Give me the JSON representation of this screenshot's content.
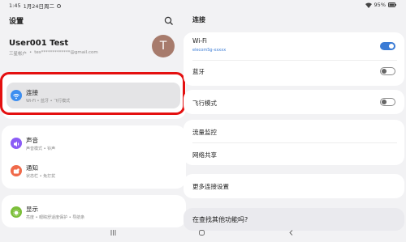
{
  "status": {
    "time": "1:45",
    "date": "1月24日周二",
    "battery": "95%"
  },
  "left": {
    "title": "设置",
    "profile": {
      "name": "User001 Test",
      "account_label": "三星帐户",
      "email": "tes*************@gmail.com",
      "avatar_letter": "T"
    },
    "items": [
      {
        "label": "连接",
        "sub": "Wi-Fi • 蓝牙 • 飞行模式",
        "color": "#3d8ef0"
      },
      {
        "label": "声音",
        "sub": "声音模式 • 铃声",
        "color": "#8b5cf6"
      },
      {
        "label": "通知",
        "sub": "状态栏 • 免打扰",
        "color": "#f06a4a"
      },
      {
        "label": "显示",
        "sub": "亮度 • 眼睛舒适度保护 • 导航条",
        "color": "#7cbf3a"
      }
    ]
  },
  "right": {
    "title": "连接",
    "wifi": {
      "label": "Wi-Fi",
      "network": "elecomSg-xxxxx",
      "on": true
    },
    "bluetooth": {
      "label": "蓝牙",
      "on": false
    },
    "airplane": {
      "label": "飞行模式",
      "on": false
    },
    "data_usage": "流量监控",
    "hotspot": "网络共享",
    "more": "更多连接设置",
    "looking": "在查找其他功能吗?"
  },
  "colors": {
    "accent": "#3a7bd5",
    "highlight": "#e41010"
  }
}
